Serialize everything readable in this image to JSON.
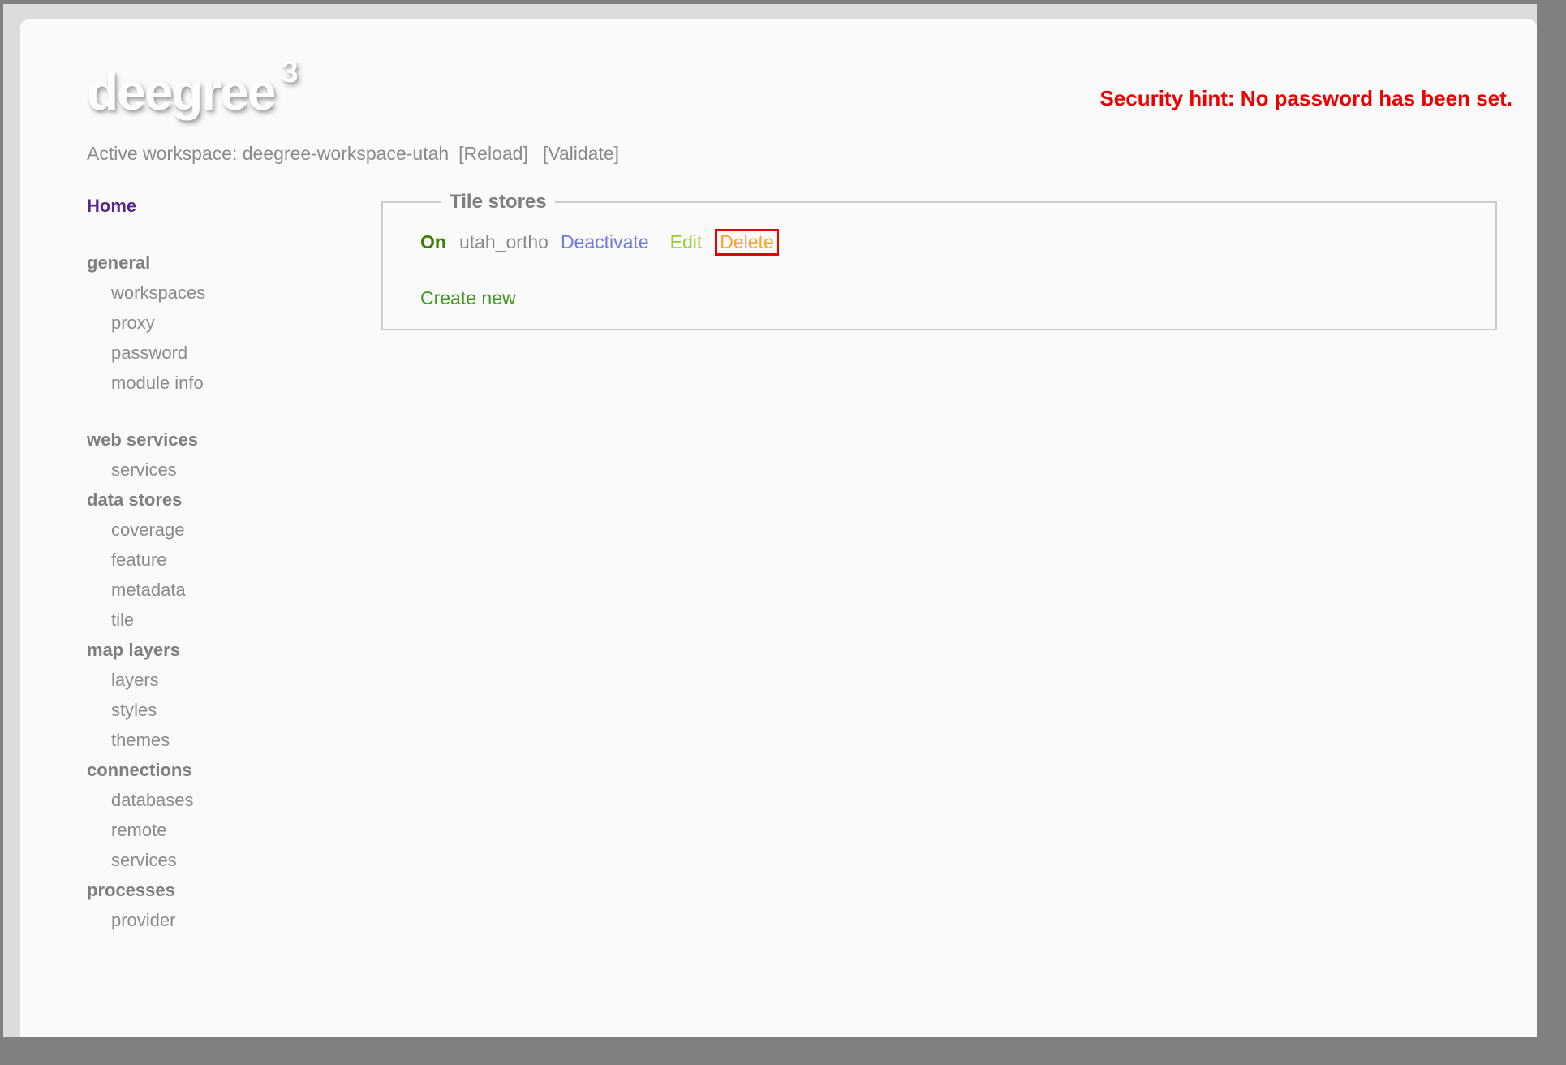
{
  "header": {
    "logo_text": "deegree",
    "logo_sup": "3",
    "security_hint": "Security hint: No password has been set.",
    "workspace_text": "Active workspace: deegree-workspace-utah",
    "reload_label": "[Reload]",
    "validate_label": "[Validate]"
  },
  "sidebar": {
    "home_label": "Home",
    "groups": [
      {
        "header": "general",
        "items": [
          "workspaces",
          "proxy",
          "password",
          "module info"
        ],
        "gap_after": true
      },
      {
        "header": "web services",
        "items": [
          "services"
        ],
        "gap_after": false
      },
      {
        "header": "data stores",
        "items": [
          "coverage",
          "feature",
          "metadata",
          "tile"
        ],
        "gap_after": false
      },
      {
        "header": "map layers",
        "items": [
          "layers",
          "styles",
          "themes"
        ],
        "gap_after": false
      },
      {
        "header": "connections",
        "items": [
          "databases",
          "remote",
          "services"
        ],
        "gap_after": false
      },
      {
        "header": "processes",
        "items": [
          "provider"
        ],
        "gap_after": false
      }
    ]
  },
  "main": {
    "fieldset_legend": "Tile stores",
    "store_row": {
      "status": "On",
      "name": "utah_ortho",
      "actions": [
        {
          "label": "Deactivate",
          "highlighted": false
        },
        {
          "label": "Edit",
          "highlighted": false
        },
        {
          "label": "Delete",
          "highlighted": true
        }
      ]
    },
    "create_new_label": "Create new"
  },
  "colors": {
    "frame-bg": "#808080",
    "viewport-bg": "#dcdcdc",
    "panel-bg": "#fafafa",
    "logo-color": "#fdfdfd",
    "hint-red": "#ee0000",
    "text-gray": "#8a8a8a",
    "header-gray": "#7e7e7e",
    "home-purple": "#54278f",
    "on-green": "#3c7f04",
    "deactivate-blue": "#7277dd",
    "edit-yellowgreen": "#9acd32",
    "delete-orange": "#f5a828",
    "delete-border-red": "#ee0000",
    "create-green": "#3f9a1f",
    "fieldset-border": "#cccccc"
  }
}
